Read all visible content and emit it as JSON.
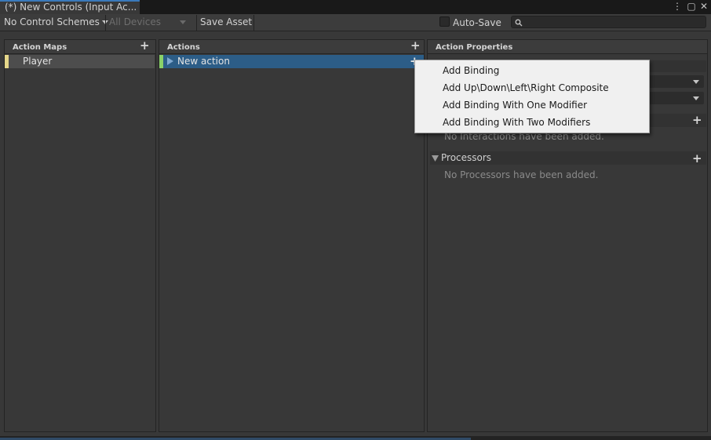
{
  "window": {
    "tab_title": "(*) New Controls (Input Ac...",
    "menu_icon": "⋮",
    "maximize_icon": "▢",
    "close_icon": "✕"
  },
  "toolbar": {
    "control_schemes": "No Control Schemes",
    "devices": "All Devices",
    "save_asset": "Save Asset",
    "auto_save": "Auto-Save",
    "search_placeholder": ""
  },
  "action_maps": {
    "header": "Action Maps",
    "items": [
      {
        "label": "Player"
      }
    ]
  },
  "actions": {
    "header": "Actions",
    "items": [
      {
        "label": "New action"
      }
    ]
  },
  "properties": {
    "header": "Action Properties",
    "interactions_empty": "No Interactions have been added.",
    "processors_label": "Processors",
    "processors_empty": "No Processors have been added."
  },
  "context_menu": {
    "items": [
      {
        "label": "Add Binding"
      },
      {
        "label": "Add Up\\Down\\Left\\Right Composite"
      },
      {
        "label": "Add Binding With One Modifier"
      },
      {
        "label": "Add Binding With Two Modifiers"
      }
    ]
  },
  "colors": {
    "selection": "#2c5d87",
    "map_marker": "#e5d78a",
    "action_marker": "#8ad169",
    "tab_accent": "#3a79bb"
  }
}
